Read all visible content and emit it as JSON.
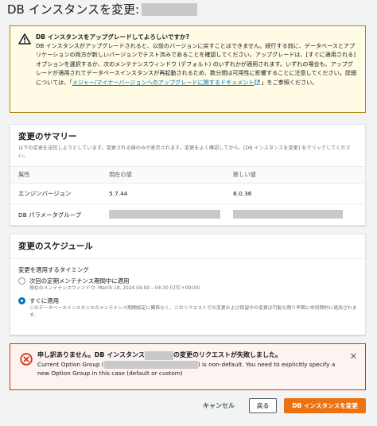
{
  "page": {
    "title": "DB インスタンスを変更:"
  },
  "warning": {
    "title": "DB インスタンスをアップグレードしてよろしいですか?",
    "body_1": "DB インスタンスがアップグレードされると、以前のバージョンに戻すことはできません。続行する前に、データベースとアプリケーションの両方が新しいバージョンでテスト済みであることを確認してください。アップグレードは、[すぐに適用される] オプションを選択するか、次のメンテナンスウィンドウ (デフォルト) のいずれかが適用されます。いずれの場合も、アップグレードが適用されてデータベースインスタンスが再起動されるため、数分間は可用性に影響することに注意してください。詳細については、「",
    "link": "メジャー/マイナーバージョンへのアップグレードに関するドキュメント",
    "body_2": "」をご参照ください。"
  },
  "summary": {
    "title": "変更のサマリー",
    "desc": "以下の変更を送信しようとしています。変更される値のみが表示されます。変更をよく確認してから、[DB インスタンスを変更] をクリックしてください。",
    "headers": [
      "属性",
      "現在の値",
      "新しい値"
    ],
    "rows": [
      {
        "attr": "エンジンバージョン",
        "current": "5.7.44",
        "new": "8.0.36"
      },
      {
        "attr": "DB パラメータグループ",
        "current": "",
        "new": ""
      }
    ]
  },
  "schedule": {
    "title": "変更のスケジュール",
    "label": "変更を適用するタイミング",
    "options": [
      {
        "label": "次回の定期メンテナンス期間中に適用",
        "sub": "現在のメンテナンスウィンドウ: March 18, 2024 04:00 – 04:30 (UTC+09:00)",
        "checked": false
      },
      {
        "label": "すぐに適用",
        "sub": "このデータベースインスタンスのメンテナンス期間設定に関係なく、このリクエストでの変更および保留中の変更は可能な限り早期に非同期的に適用されます。",
        "checked": true
      }
    ]
  },
  "error": {
    "title_1": "申し訳ありません。DB インスタンス",
    "title_2": "の変更のリクエストが失敗しました。",
    "msg_1": "Current Option Group (",
    "msg_2": ") is non-default. You need to explicitly specify a new Option Group in this case (default or custom)",
    "close_icon": "close-icon"
  },
  "footer": {
    "cancel": "キャンセル",
    "back": "戻る",
    "submit": "DB インスタンスを変更"
  },
  "colors": {
    "accent": "#ec7211",
    "link": "#0073bb",
    "error": "#d13212",
    "warning": "#a8880e"
  }
}
